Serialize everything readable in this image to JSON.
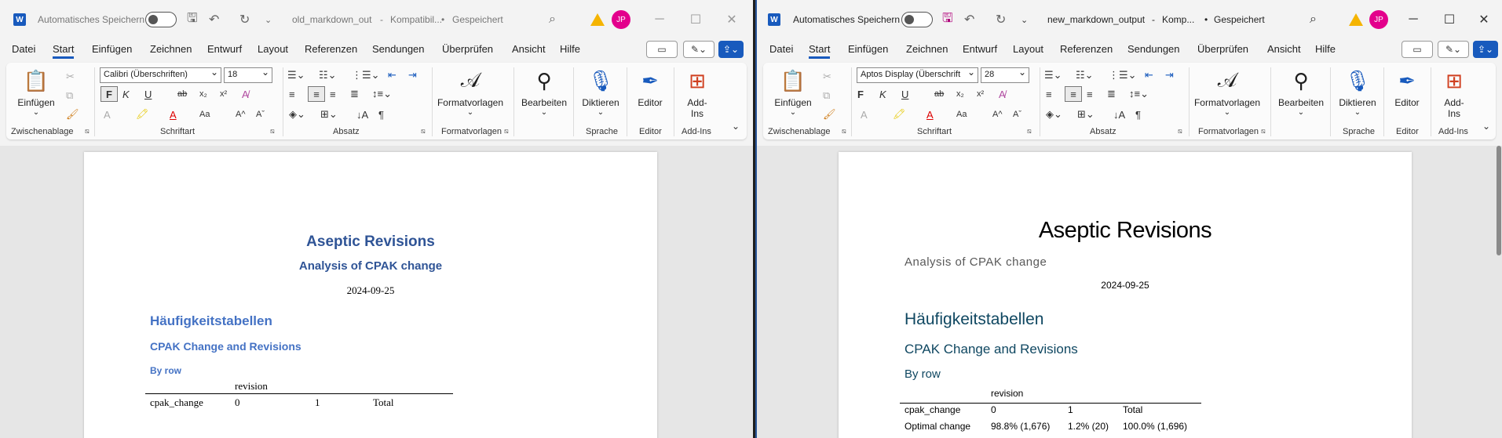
{
  "colors": {
    "accent": "#185abd",
    "heading_old": "#2f5496",
    "heading_sub_old": "#4472c4",
    "heading_new": "#0f4761",
    "avatar": "#e3008c"
  },
  "common": {
    "autosave": "Automatisches Speichern",
    "status": "Gespeichert",
    "avatar": "JP",
    "menu": [
      "Datei",
      "Start",
      "Einfügen",
      "Zeichnen",
      "Entwurf",
      "Layout",
      "Referenzen",
      "Sendungen",
      "Überprüfen",
      "Ansicht",
      "Hilfe"
    ],
    "ribbon": {
      "paste": "Einfügen",
      "clipboard_group": "Zwischenablage",
      "font_group": "Schriftart",
      "paragraph_group": "Absatz",
      "styles": "Formatvorlagen",
      "styles_group": "Formatvorlagen",
      "editing": "Bearbeiten",
      "dictate": "Diktieren",
      "voice_group": "Sprache",
      "editor": "Editor",
      "editor_group": "Editor",
      "addins": "Add-Ins",
      "addins_group": "Add-Ins",
      "bold": "F",
      "italic": "K",
      "underline": "U",
      "strike": "ab",
      "sub": "x₂",
      "sup": "x²",
      "case": "Aa",
      "grow": "A^",
      "shrink": "Aˇ"
    }
  },
  "left": {
    "filename": "old_markdown_out",
    "mode": "Kompatibil...",
    "font": "Calibri (Überschriften)",
    "size": "18",
    "doc": {
      "title": "Aseptic Revisions",
      "subtitle": "Analysis of CPAK change",
      "date": "2024-09-25",
      "h1": "Häufigkeitstabellen",
      "h2": "CPAK Change and Revisions",
      "h3": "By row",
      "table": {
        "group_header": "revision",
        "row_header": "cpak_change",
        "cols": [
          "0",
          "1",
          "Total"
        ]
      }
    }
  },
  "right": {
    "filename": "new_markdown_output",
    "mode": "Komp...",
    "font": "Aptos Display (Überschrift",
    "size": "28",
    "doc": {
      "title": "Aseptic Revisions",
      "subtitle": "Analysis of CPAK change",
      "date": "2024-09-25",
      "h1": "Häufigkeitstabellen",
      "h2": "CPAK Change and Revisions",
      "h3": "By row",
      "table": {
        "group_header": "revision",
        "row_header": "cpak_change",
        "cols": [
          "0",
          "1",
          "Total"
        ],
        "row1": {
          "label": "Optimal change",
          "c0": "98.8% (1,676)",
          "c1": "1.2% (20)",
          "total": "100.0% (1,696)"
        }
      }
    }
  }
}
